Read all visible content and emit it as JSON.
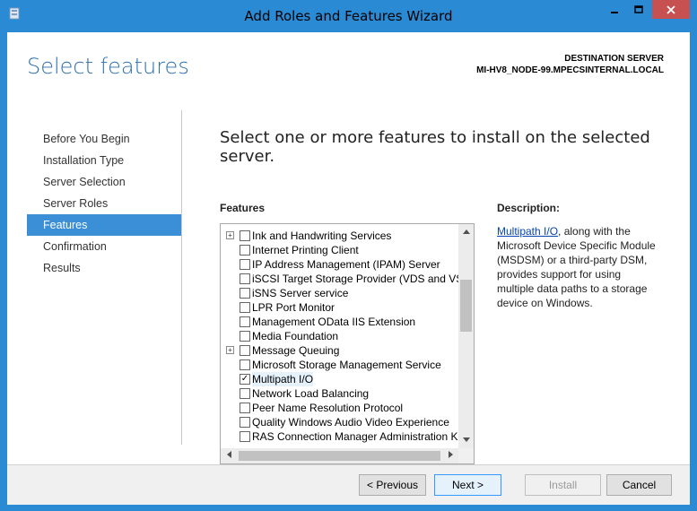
{
  "window": {
    "title": "Add Roles and Features Wizard",
    "controls": {
      "minimize": "–",
      "maximize": "□",
      "close": "✕"
    }
  },
  "header": {
    "page_title": "Select features",
    "destination_label": "DESTINATION SERVER",
    "destination_name": "MI-HV8_NODE-99.MPECSINTERNAL.LOCAL"
  },
  "nav": {
    "items": [
      {
        "label": "Before You Begin"
      },
      {
        "label": "Installation Type"
      },
      {
        "label": "Server Selection"
      },
      {
        "label": "Server Roles"
      },
      {
        "label": "Features",
        "active": true
      },
      {
        "label": "Confirmation"
      },
      {
        "label": "Results"
      }
    ]
  },
  "main": {
    "instruction": "Select one or more features to install on the selected server.",
    "features_label": "Features",
    "description_label": "Description:",
    "description_link": "Multipath I/O",
    "description_text": ", along with the Microsoft Device Specific Module (MSDSM) or a third-party DSM, provides support for using multiple data paths to a storage device on Windows."
  },
  "features": [
    {
      "label": "Ink and Handwriting Services",
      "expandable": true,
      "checked": false
    },
    {
      "label": "Internet Printing Client",
      "expandable": false,
      "checked": false
    },
    {
      "label": "IP Address Management (IPAM) Server",
      "expandable": false,
      "checked": false
    },
    {
      "label": "iSCSI Target Storage Provider (VDS and VSS",
      "expandable": false,
      "checked": false
    },
    {
      "label": "iSNS Server service",
      "expandable": false,
      "checked": false
    },
    {
      "label": "LPR Port Monitor",
      "expandable": false,
      "checked": false
    },
    {
      "label": "Management OData IIS Extension",
      "expandable": false,
      "checked": false
    },
    {
      "label": "Media Foundation",
      "expandable": false,
      "checked": false
    },
    {
      "label": "Message Queuing",
      "expandable": true,
      "checked": false
    },
    {
      "label": "Microsoft Storage Management Service",
      "expandable": false,
      "checked": false
    },
    {
      "label": "Multipath I/O",
      "expandable": false,
      "checked": true,
      "selected": true
    },
    {
      "label": "Network Load Balancing",
      "expandable": false,
      "checked": false
    },
    {
      "label": "Peer Name Resolution Protocol",
      "expandable": false,
      "checked": false
    },
    {
      "label": "Quality Windows Audio Video Experience",
      "expandable": false,
      "checked": false
    },
    {
      "label": "RAS Connection Manager Administration Ki",
      "expandable": false,
      "checked": false
    }
  ],
  "buttons": {
    "previous": "< Previous",
    "next": "Next >",
    "install": "Install",
    "cancel": "Cancel"
  },
  "colors": {
    "accent": "#2a8ad4",
    "nav_active": "#3a8fd6",
    "title_blue": "#2a6fb0",
    "close_red": "#c75050"
  }
}
